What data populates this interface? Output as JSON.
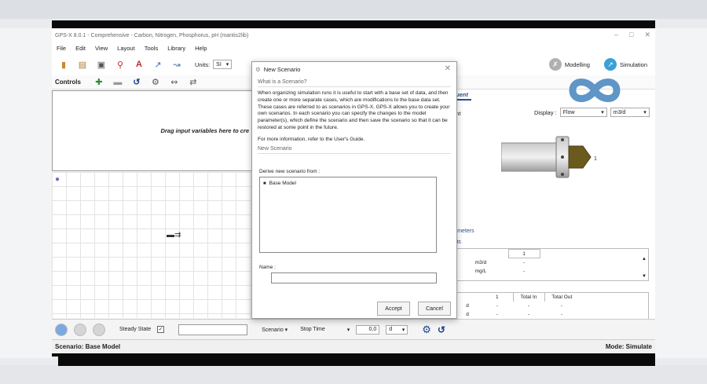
{
  "app": {
    "title": "GPS-X 8.0.1 - Comprehensive - Carbon, Nitrogen, Phosphorus, pH (mantis2lib)"
  },
  "menu": [
    "File",
    "Edit",
    "View",
    "Layout",
    "Tools",
    "Library",
    "Help"
  ],
  "toolbar": {
    "units_label": "Units:",
    "units_value": "SI",
    "modelling_label": "Modelling",
    "simulation_label": "Simulation"
  },
  "controls": {
    "label": "Controls",
    "drop_hint": "Drag input variables here to cre"
  },
  "right_panel": {
    "tab_label": "uent",
    "pane_label": "ent",
    "display_label": "Display :",
    "display_value": "Flow",
    "unit_value": "m3/d",
    "pipe_label": "1",
    "section_parameters": "rameters",
    "section_results": "ults",
    "table1": {
      "header": "1",
      "rows": [
        {
          "unit": "m3/d",
          "value": "-"
        },
        {
          "unit": "mg/L",
          "value": "-"
        },
        {
          "unit": "mg/L",
          "value": ""
        }
      ]
    },
    "table2": {
      "headers": [
        "1",
        "Total In",
        "Total Out"
      ],
      "rows": [
        {
          "unit": "d",
          "values": [
            "-",
            "-",
            "-"
          ]
        },
        {
          "unit": "d",
          "values": [
            "-",
            "-",
            "-"
          ]
        },
        {
          "unit": "d",
          "values": [
            "-",
            "-",
            "-"
          ]
        },
        {
          "unit": "d",
          "values": [
            "-",
            "-",
            "-"
          ]
        }
      ]
    }
  },
  "dialog": {
    "title": "New Scenario",
    "section1": "What is a Scenario?",
    "paragraph1": "When organizing simulation runs it is useful to start with a base set of data, and then create one or more separate cases, which are modifications to the base data set. These cases are referred to as scenarios in GPS-X. GPS-X allows you to create your own scenarios. In each scenario you can specify the changes to the model parameter(s), which define the scenario and then save the scenario so that it can be restored at some point in the future.",
    "paragraph2": "For more information, refer to the User's Guide.",
    "section2": "New Scenario",
    "derive_label": "Derive new scenario from :",
    "list_items": [
      "Base Model"
    ],
    "name_label": "Name :",
    "name_value": "",
    "accept_label": "Accept",
    "cancel_label": "Cancel"
  },
  "bottom": {
    "steady_state_label": "Steady State",
    "scenario_label": "Scenario",
    "stop_time_label": "Stop Time",
    "stop_time_value": "0,0",
    "stop_time_unit": "d"
  },
  "status": {
    "scenario_text": "Scenario: Base Model",
    "mode_text": "Mode: Simulate"
  },
  "colors": {
    "accent": "#2b4f8c",
    "modelling_icon": "#b0b0b0",
    "simulation_icon": "#3aa0d8",
    "logo": "#5f95c7"
  }
}
